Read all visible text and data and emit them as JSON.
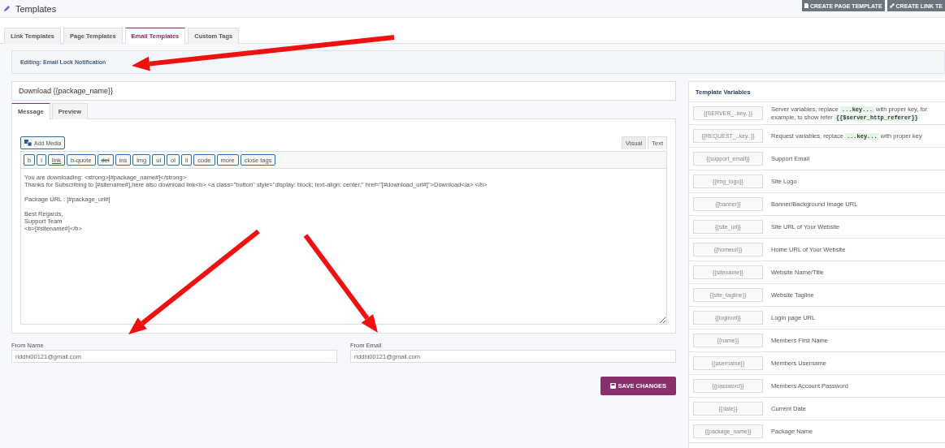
{
  "header": {
    "title": "Templates",
    "buttons": [
      {
        "label": "CREATE PAGE TEMPLATE",
        "kind": "page"
      },
      {
        "label": "CREATE LINK TE",
        "kind": "link"
      }
    ]
  },
  "tabs": [
    {
      "label": "Link Templates",
      "selected": false
    },
    {
      "label": "Page Templates",
      "selected": false
    },
    {
      "label": "Email Templates",
      "selected": true
    },
    {
      "label": "Custom Tags",
      "selected": false
    }
  ],
  "editing_notice": "Editing: Email Lock Notification",
  "subject": "Download {{package_name}}",
  "editor_tabs": [
    {
      "label": "Message",
      "selected": true
    },
    {
      "label": "Preview",
      "selected": false
    }
  ],
  "add_media": "Add Media",
  "mode_tabs": [
    {
      "label": "Visual",
      "selected": false
    },
    {
      "label": "Text",
      "selected": true
    }
  ],
  "quicktags": [
    {
      "label": "b",
      "kind": "plain"
    },
    {
      "label": "i",
      "kind": "plain"
    },
    {
      "label": "link",
      "kind": "link"
    },
    {
      "label": "b-quote",
      "kind": "plain"
    },
    {
      "label": "del",
      "kind": "strike"
    },
    {
      "label": "ins",
      "kind": "plain"
    },
    {
      "label": "img",
      "kind": "plain"
    },
    {
      "label": "ul",
      "kind": "plain"
    },
    {
      "label": "ol",
      "kind": "plain"
    },
    {
      "label": "li",
      "kind": "plain"
    },
    {
      "label": "code",
      "kind": "plain"
    },
    {
      "label": "more",
      "kind": "plain"
    },
    {
      "label": "close tags",
      "kind": "plain"
    }
  ],
  "message_paragraphs": [
    [
      "You are downloading: <strong>[#package_name#]</strong>",
      "Thanks for Subscribing to [#sitename#],here also download link<b> <a class=\"button\" style=\"display: block; text-align: center;\" href=\"[#download_url#]\">Download</a> </b>"
    ],
    [
      "Package URL : [#package_url#]"
    ],
    [
      "Best Regards,",
      "Support Team",
      "<b>[#sitename#]</b>"
    ]
  ],
  "from_name": {
    "label": "From Name",
    "value": "riddhi00121@gmail.com"
  },
  "from_email": {
    "label": "From Email",
    "value": "riddhi00121@gmail.com"
  },
  "save_button": "SAVE CHANGES",
  "variables": {
    "title": "Template Variables",
    "rows": [
      {
        "tag": "{{SERVER_..key..}}",
        "parts": [
          {
            "kind": "text",
            "text": "Server variables, replace"
          },
          {
            "kind": "code",
            "text": "...key..."
          },
          {
            "kind": "text",
            "text": "with proper key, for example, to show refer"
          },
          {
            "kind": "code",
            "text": "{{$server_http_referer}}"
          }
        ]
      },
      {
        "tag": "{{REQUEST_..key..}}",
        "parts": [
          {
            "kind": "text",
            "text": "Request variables, replace"
          },
          {
            "kind": "code",
            "text": "...key..."
          },
          {
            "kind": "text",
            "text": "with proper key"
          }
        ]
      },
      {
        "tag": "{{support_email}}",
        "parts": [
          {
            "kind": "text",
            "text": "Support Email"
          }
        ]
      },
      {
        "tag": "{{img_logo}}",
        "parts": [
          {
            "kind": "text",
            "text": "Site Logo"
          }
        ]
      },
      {
        "tag": "{{banner}}",
        "parts": [
          {
            "kind": "text",
            "text": "Banner/Background Image URL"
          }
        ]
      },
      {
        "tag": "{{site_url}}",
        "parts": [
          {
            "kind": "text",
            "text": "Site URL of Your Website"
          }
        ]
      },
      {
        "tag": "{{homeurl}}",
        "parts": [
          {
            "kind": "text",
            "text": "Home URL of Your Website"
          }
        ]
      },
      {
        "tag": "{{sitename}}",
        "parts": [
          {
            "kind": "text",
            "text": "Website Name/Title"
          }
        ]
      },
      {
        "tag": "{{site_tagline}}",
        "parts": [
          {
            "kind": "text",
            "text": "Website Tagline"
          }
        ]
      },
      {
        "tag": "{{loginurl}}",
        "parts": [
          {
            "kind": "text",
            "text": "Login page URL"
          }
        ]
      },
      {
        "tag": "{{name}}",
        "parts": [
          {
            "kind": "text",
            "text": "Members First Name"
          }
        ]
      },
      {
        "tag": "{{username}}",
        "parts": [
          {
            "kind": "text",
            "text": "Members Username"
          }
        ]
      },
      {
        "tag": "{{password}}",
        "parts": [
          {
            "kind": "text",
            "text": "Members Account Password"
          }
        ]
      },
      {
        "tag": "{{date}}",
        "parts": [
          {
            "kind": "text",
            "text": "Current Date"
          }
        ]
      },
      {
        "tag": "{{package_name}}",
        "parts": [
          {
            "kind": "text",
            "text": "Package Name"
          }
        ]
      }
    ]
  }
}
